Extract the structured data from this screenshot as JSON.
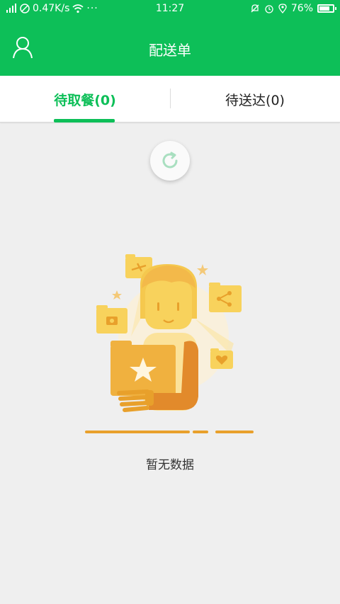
{
  "status_bar": {
    "net_speed": "0.47K/s",
    "time": "11:27",
    "battery_percent": "76%",
    "battery_level": 0.76,
    "icons": [
      "signal-icon",
      "no-disturb-icon",
      "wifi-icon",
      "more-dots-icon",
      "mute-icon",
      "alarm-icon",
      "location-icon",
      "battery-icon"
    ]
  },
  "header": {
    "title": "配送单",
    "user_icon": "user-icon"
  },
  "tabs": [
    {
      "label": "待取餐(0)",
      "active": true
    },
    {
      "label": "待送达(0)",
      "active": false
    }
  ],
  "refresh_icon": "refresh-icon",
  "empty_state": {
    "illustration": "empty-state-illustration",
    "text": "暂无数据"
  },
  "colors": {
    "brand": "#0dbf58",
    "background": "#efefef",
    "illustration_yellow": "#f8d25c",
    "illustration_orange": "#e8a02b"
  }
}
